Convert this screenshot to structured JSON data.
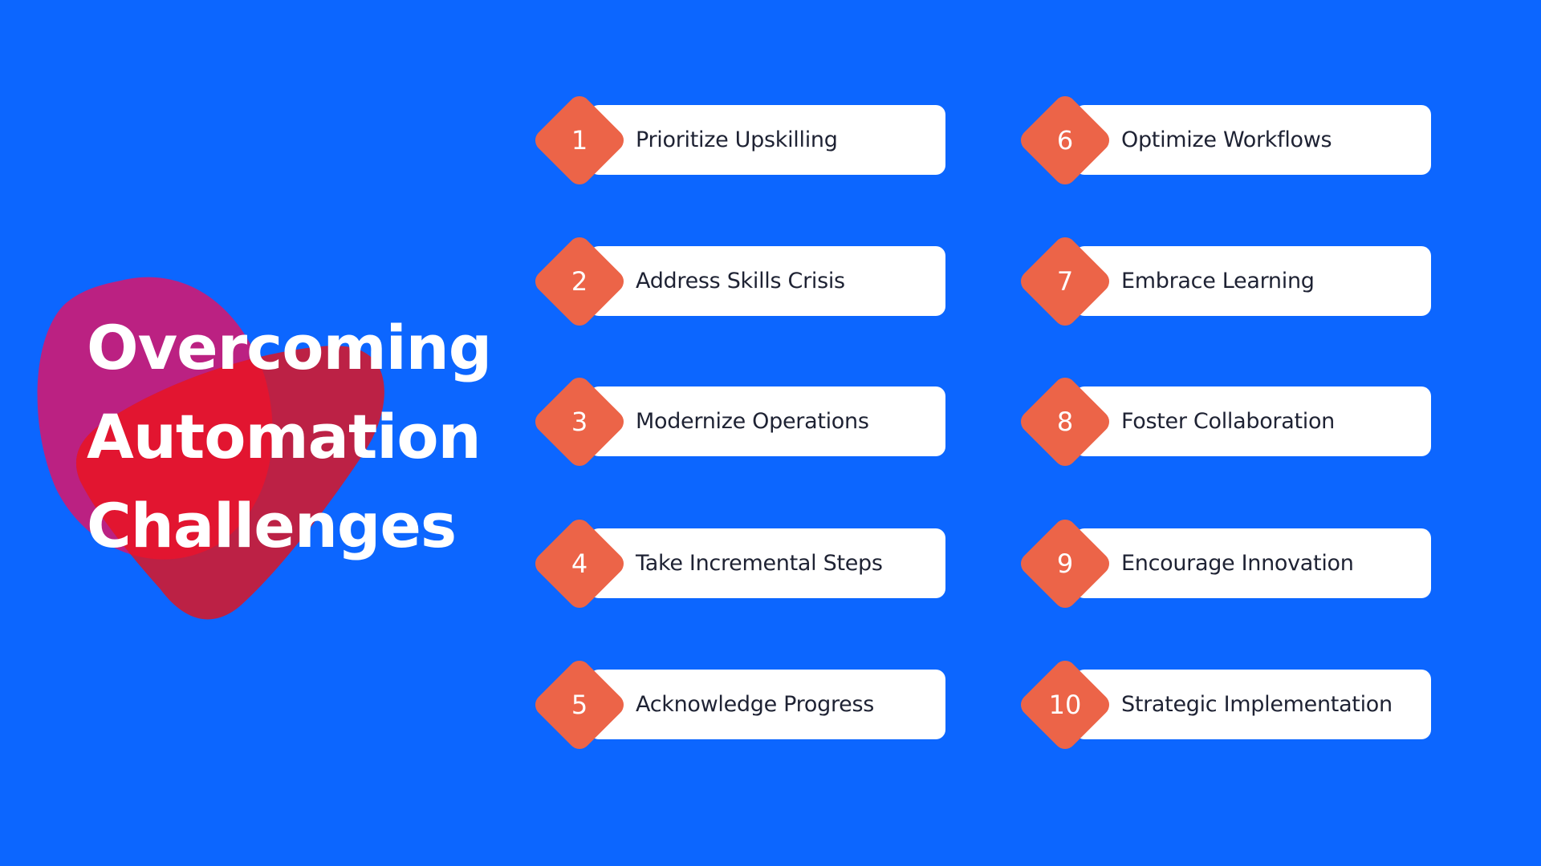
{
  "title": {
    "lines": [
      "Overcoming",
      "Automation",
      "Challenges"
    ]
  },
  "colors": {
    "background": "#0C66FF",
    "accent": "#EC6448",
    "card": "#FFFFFF",
    "text": "#1E2233",
    "blob_magenta": "#BB2182",
    "blob_crimson": "#BC2145",
    "blob_overlap": "#E21530"
  },
  "steps": [
    {
      "number": "1",
      "label": "Prioritize Upskilling"
    },
    {
      "number": "2",
      "label": "Address Skills Crisis"
    },
    {
      "number": "3",
      "label": "Modernize Operations"
    },
    {
      "number": "4",
      "label": "Take Incremental Steps"
    },
    {
      "number": "5",
      "label": "Acknowledge Progress"
    },
    {
      "number": "6",
      "label": "Optimize Workflows"
    },
    {
      "number": "7",
      "label": "Embrace Learning"
    },
    {
      "number": "8",
      "label": "Foster Collaboration"
    },
    {
      "number": "9",
      "label": "Encourage Innovation"
    },
    {
      "number": "10",
      "label": "Strategic Implementation"
    }
  ]
}
